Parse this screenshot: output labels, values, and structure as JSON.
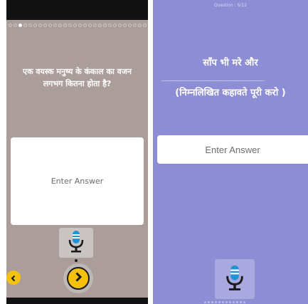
{
  "left_screen": {
    "question_text": "एक वयस्क मनुष्य के कंकाल का वजन लगभग कितना होता है?",
    "answer_placeholder": "Enter Answer",
    "progress_total": 28,
    "progress_current": 3,
    "mic_icon": "microphone-icon",
    "prev_icon": "chevron-left-icon",
    "next_icon": "chevron-right-icon",
    "colors": {
      "background": "#ab9e9a",
      "accent": "#f4c20d",
      "mic_blue": "#1f93d6"
    }
  },
  "right_screen": {
    "question_number": "Question : 6/12",
    "question_line1": "साँप भी मरे और",
    "question_blank": "____________________",
    "question_line2": "(निम्नलिखित कहावते पूरी करो )",
    "answer_placeholder": "Enter Answer",
    "mic_icon": "microphone-icon",
    "colors": {
      "background": "#8d8dd6",
      "mic_blue": "#1f93d6"
    }
  }
}
